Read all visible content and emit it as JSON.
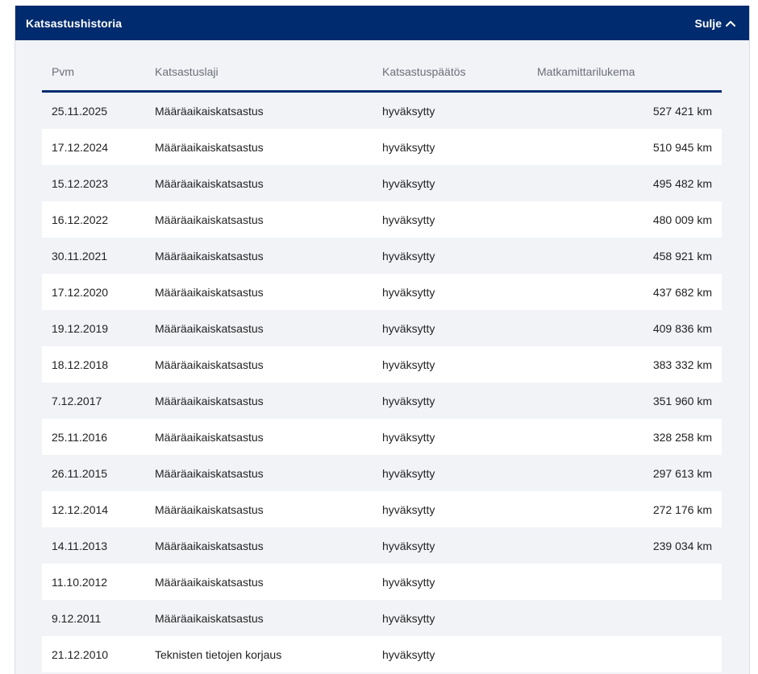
{
  "panel": {
    "title": "Katsastushistoria",
    "close_label": "Sulje",
    "close_icon": "chevron-up-icon"
  },
  "table": {
    "headers": [
      "Pvm",
      "Katsastuslaji",
      "Katsastuspäätös",
      "Matkamittarilukema"
    ],
    "rows": [
      {
        "date": "25.11.2025",
        "type": "Määräaikaiskatsastus",
        "result": "hyväksytty",
        "odometer": "527 421 km"
      },
      {
        "date": "17.12.2024",
        "type": "Määräaikaiskatsastus",
        "result": "hyväksytty",
        "odometer": "510 945 km"
      },
      {
        "date": "15.12.2023",
        "type": "Määräaikaiskatsastus",
        "result": "hyväksytty",
        "odometer": "495 482 km"
      },
      {
        "date": "16.12.2022",
        "type": "Määräaikaiskatsastus",
        "result": "hyväksytty",
        "odometer": "480 009 km"
      },
      {
        "date": "30.11.2021",
        "type": "Määräaikaiskatsastus",
        "result": "hyväksytty",
        "odometer": "458 921 km"
      },
      {
        "date": "17.12.2020",
        "type": "Määräaikaiskatsastus",
        "result": "hyväksytty",
        "odometer": "437 682 km"
      },
      {
        "date": "19.12.2019",
        "type": "Määräaikaiskatsastus",
        "result": "hyväksytty",
        "odometer": "409 836 km"
      },
      {
        "date": "18.12.2018",
        "type": "Määräaikaiskatsastus",
        "result": "hyväksytty",
        "odometer": "383 332 km"
      },
      {
        "date": "7.12.2017",
        "type": "Määräaikaiskatsastus",
        "result": "hyväksytty",
        "odometer": "351 960 km"
      },
      {
        "date": "25.11.2016",
        "type": "Määräaikaiskatsastus",
        "result": "hyväksytty",
        "odometer": "328 258 km"
      },
      {
        "date": "26.11.2015",
        "type": "Määräaikaiskatsastus",
        "result": "hyväksytty",
        "odometer": "297 613 km"
      },
      {
        "date": "12.12.2014",
        "type": "Määräaikaiskatsastus",
        "result": "hyväksytty",
        "odometer": "272 176 km"
      },
      {
        "date": "14.11.2013",
        "type": "Määräaikaiskatsastus",
        "result": "hyväksytty",
        "odometer": "239 034 km"
      },
      {
        "date": "11.10.2012",
        "type": "Määräaikaiskatsastus",
        "result": "hyväksytty",
        "odometer": ""
      },
      {
        "date": "9.12.2011",
        "type": "Määräaikaiskatsastus",
        "result": "hyväksytty",
        "odometer": ""
      },
      {
        "date": "21.12.2010",
        "type": "Teknisten tietojen korjaus",
        "result": "hyväksytty",
        "odometer": ""
      }
    ]
  },
  "colors": {
    "header_bg": "#002b6e",
    "panel_bg": "#f2f3f7",
    "row_alt_bg": "#ffffff"
  }
}
